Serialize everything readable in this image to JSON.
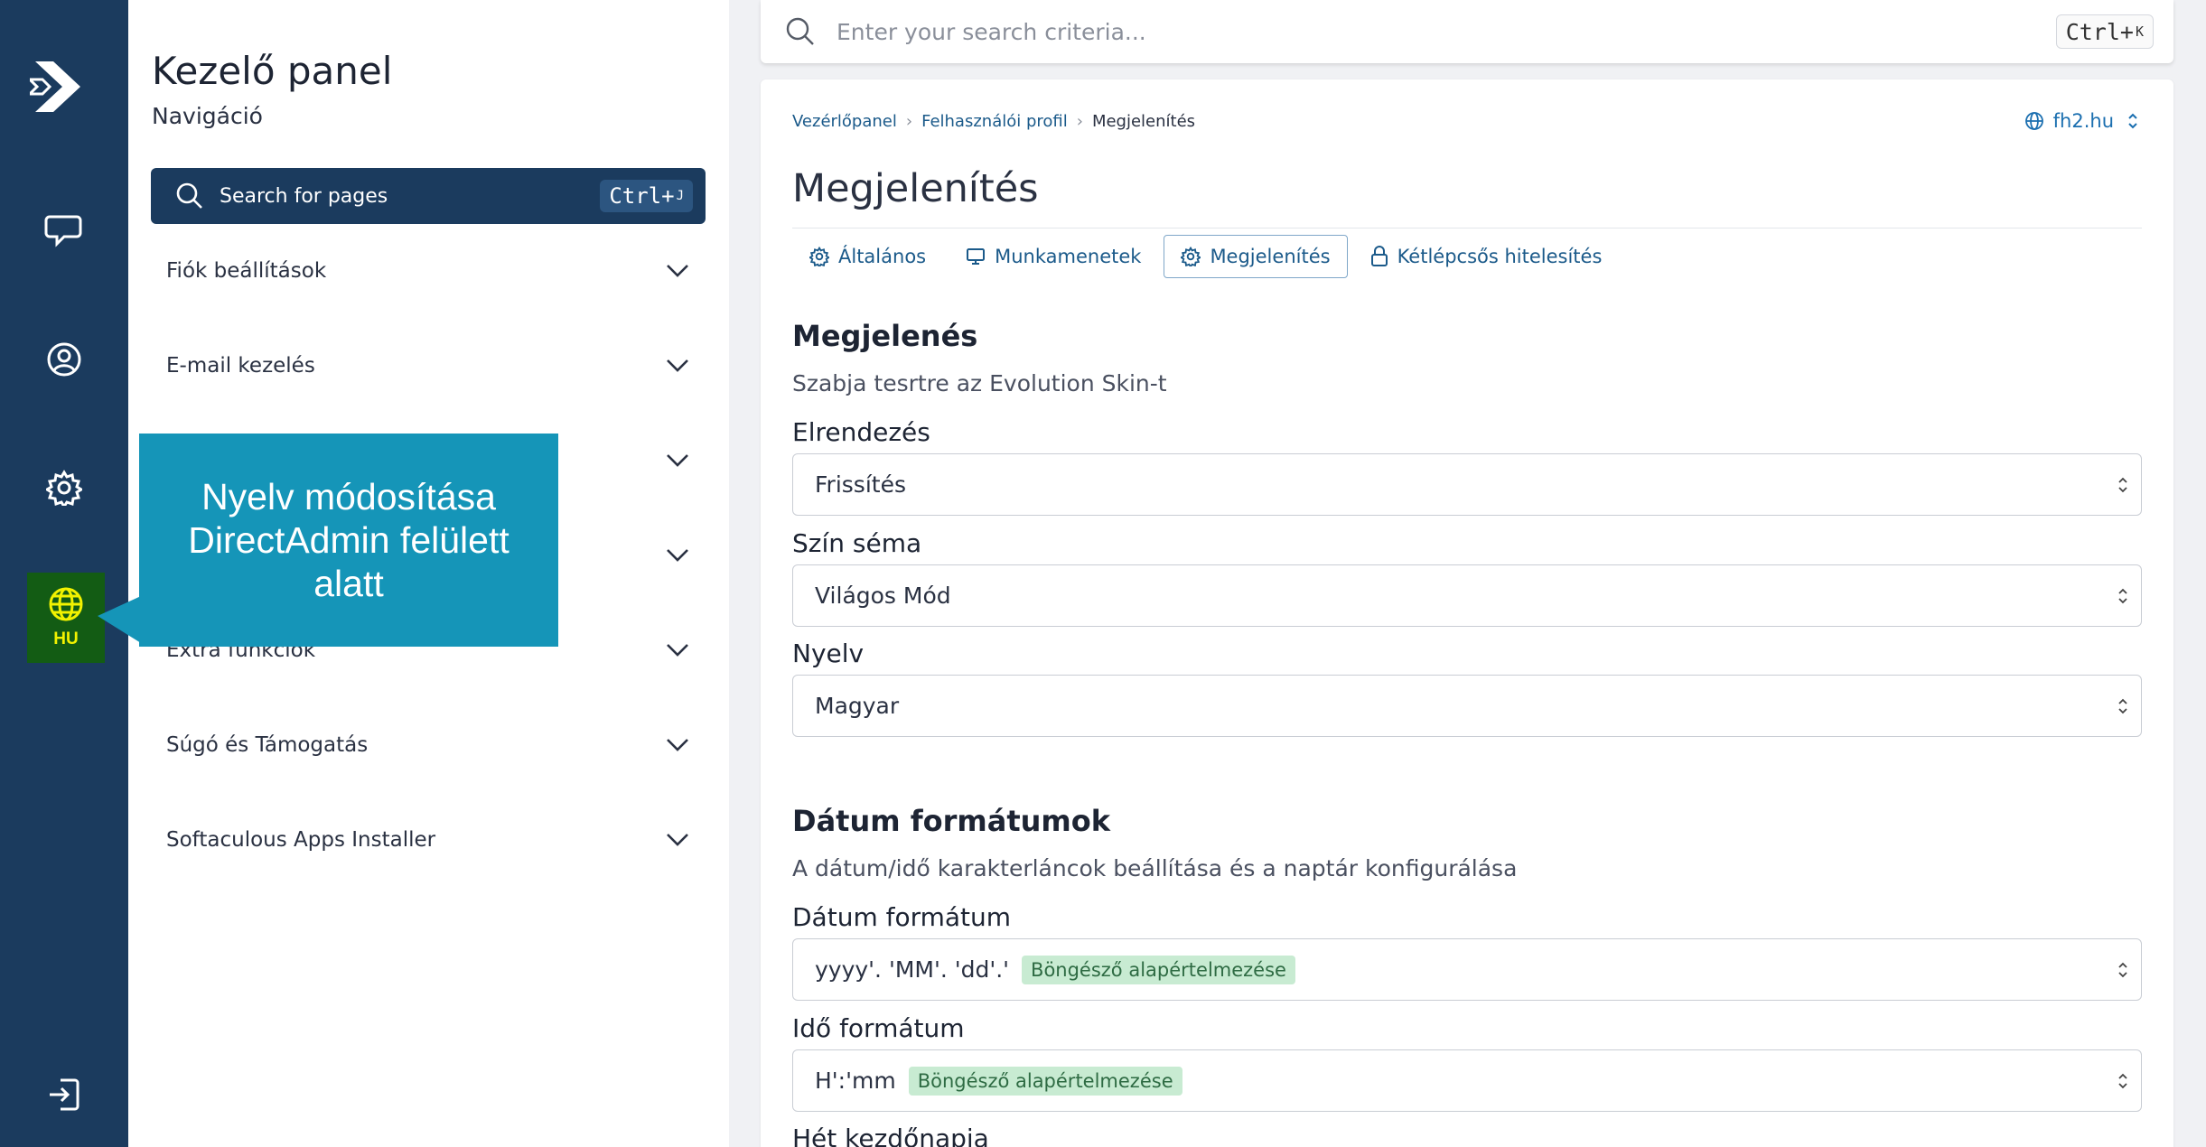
{
  "rail": {
    "language_code": "HU"
  },
  "nav": {
    "title": "Kezelő panel",
    "subtitle": "Navigáció",
    "search_label": "Search for pages",
    "search_kbd": "Ctrl+",
    "search_kbd_key": "J",
    "items": [
      {
        "label": "Fiók beállítások"
      },
      {
        "label": "E-mail kezelés"
      },
      {
        "label": ""
      },
      {
        "label": ""
      },
      {
        "label": "Extra funkciók"
      },
      {
        "label": "Súgó és Támogatás"
      },
      {
        "label": "Softaculous Apps Installer"
      }
    ]
  },
  "callout": {
    "text": "Nyelv módosítása DirectAdmin felülett alatt"
  },
  "topsearch": {
    "placeholder": "Enter your search criteria...",
    "kbd": "Ctrl+",
    "kbd_key": "K"
  },
  "breadcrumb": {
    "items": [
      "Vezérlőpanel",
      "Felhasználói profil"
    ],
    "current": "Megjelenítés"
  },
  "domain": "fh2.hu",
  "page_title": "Megjelenítés",
  "tabs": [
    {
      "label": "Általános",
      "icon": "gear-icon"
    },
    {
      "label": "Munkamenetek",
      "icon": "monitor-icon"
    },
    {
      "label": "Megjelenítés",
      "icon": "gear-icon",
      "active": true
    },
    {
      "label": "Kétlépcsős hitelesítés",
      "icon": "lock-icon"
    }
  ],
  "appearance": {
    "heading": "Megjelenés",
    "description": "Szabja tesrtre az Evolution Skin-t",
    "layout_label": "Elrendezés",
    "layout_value": "Frissítés",
    "scheme_label": "Szín séma",
    "scheme_value": "Világos Mód",
    "language_label": "Nyelv",
    "language_value": "Magyar"
  },
  "dates": {
    "heading": "Dátum formátumok",
    "description": "A dátum/idő karakterláncok beállítása és a naptár konfigurálása",
    "date_label": "Dátum formátum",
    "date_value": "yyyy'. 'MM'. 'dd'.'",
    "date_badge": "Böngésző alapértelmezése",
    "time_label": "Idő formátum",
    "time_value": "H':'mm",
    "time_badge": "Böngésző alapértelmezése",
    "week_label": "Hét kezdőnapja"
  },
  "colors": {
    "rail": "#1b3b5e",
    "lang_bg": "#135c14",
    "lang_fg": "#f2f200",
    "callout": "#1595b8",
    "link": "#1b5a8a",
    "badge_bg": "#c8ebd2"
  }
}
